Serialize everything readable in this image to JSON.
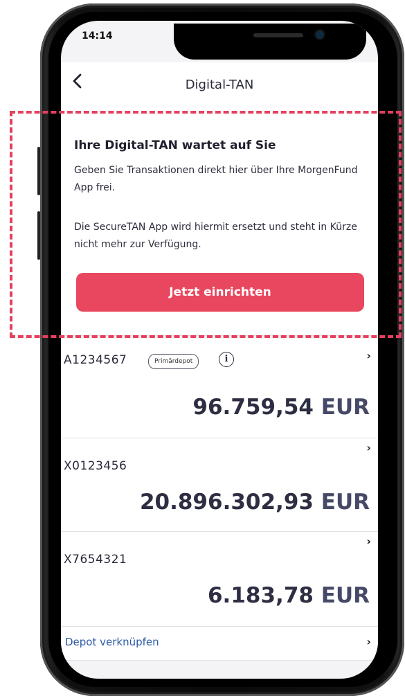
{
  "status": {
    "time": "14:14"
  },
  "nav": {
    "title": "Digital-TAN",
    "back_icon": "chevron-left-icon"
  },
  "tan_card": {
    "title": "Ihre Digital-TAN wartet auf Sie",
    "text1": "Geben Sie Transaktionen direkt hier über Ihre MorgenFund App frei.",
    "text2": "Die SecureTAN App wird hiermit  ersetzt und steht in Kürze nicht mehr zur Verfügung.",
    "button_label": "Jetzt einrichten",
    "accent_color": "#e9475f"
  },
  "depots": [
    {
      "id": "A1234567",
      "badge": "Primärdepot",
      "amount": "96.759,54",
      "currency": "EUR"
    },
    {
      "id": "X0123456",
      "amount": "20.896.302,93",
      "currency": "EUR"
    },
    {
      "id": "X7654321",
      "amount": "6.183,78",
      "currency": "EUR"
    }
  ],
  "link": {
    "label": "Depot verknüpfen"
  },
  "icons": {
    "info": "info-icon",
    "chevron": "chevron-right-icon"
  }
}
